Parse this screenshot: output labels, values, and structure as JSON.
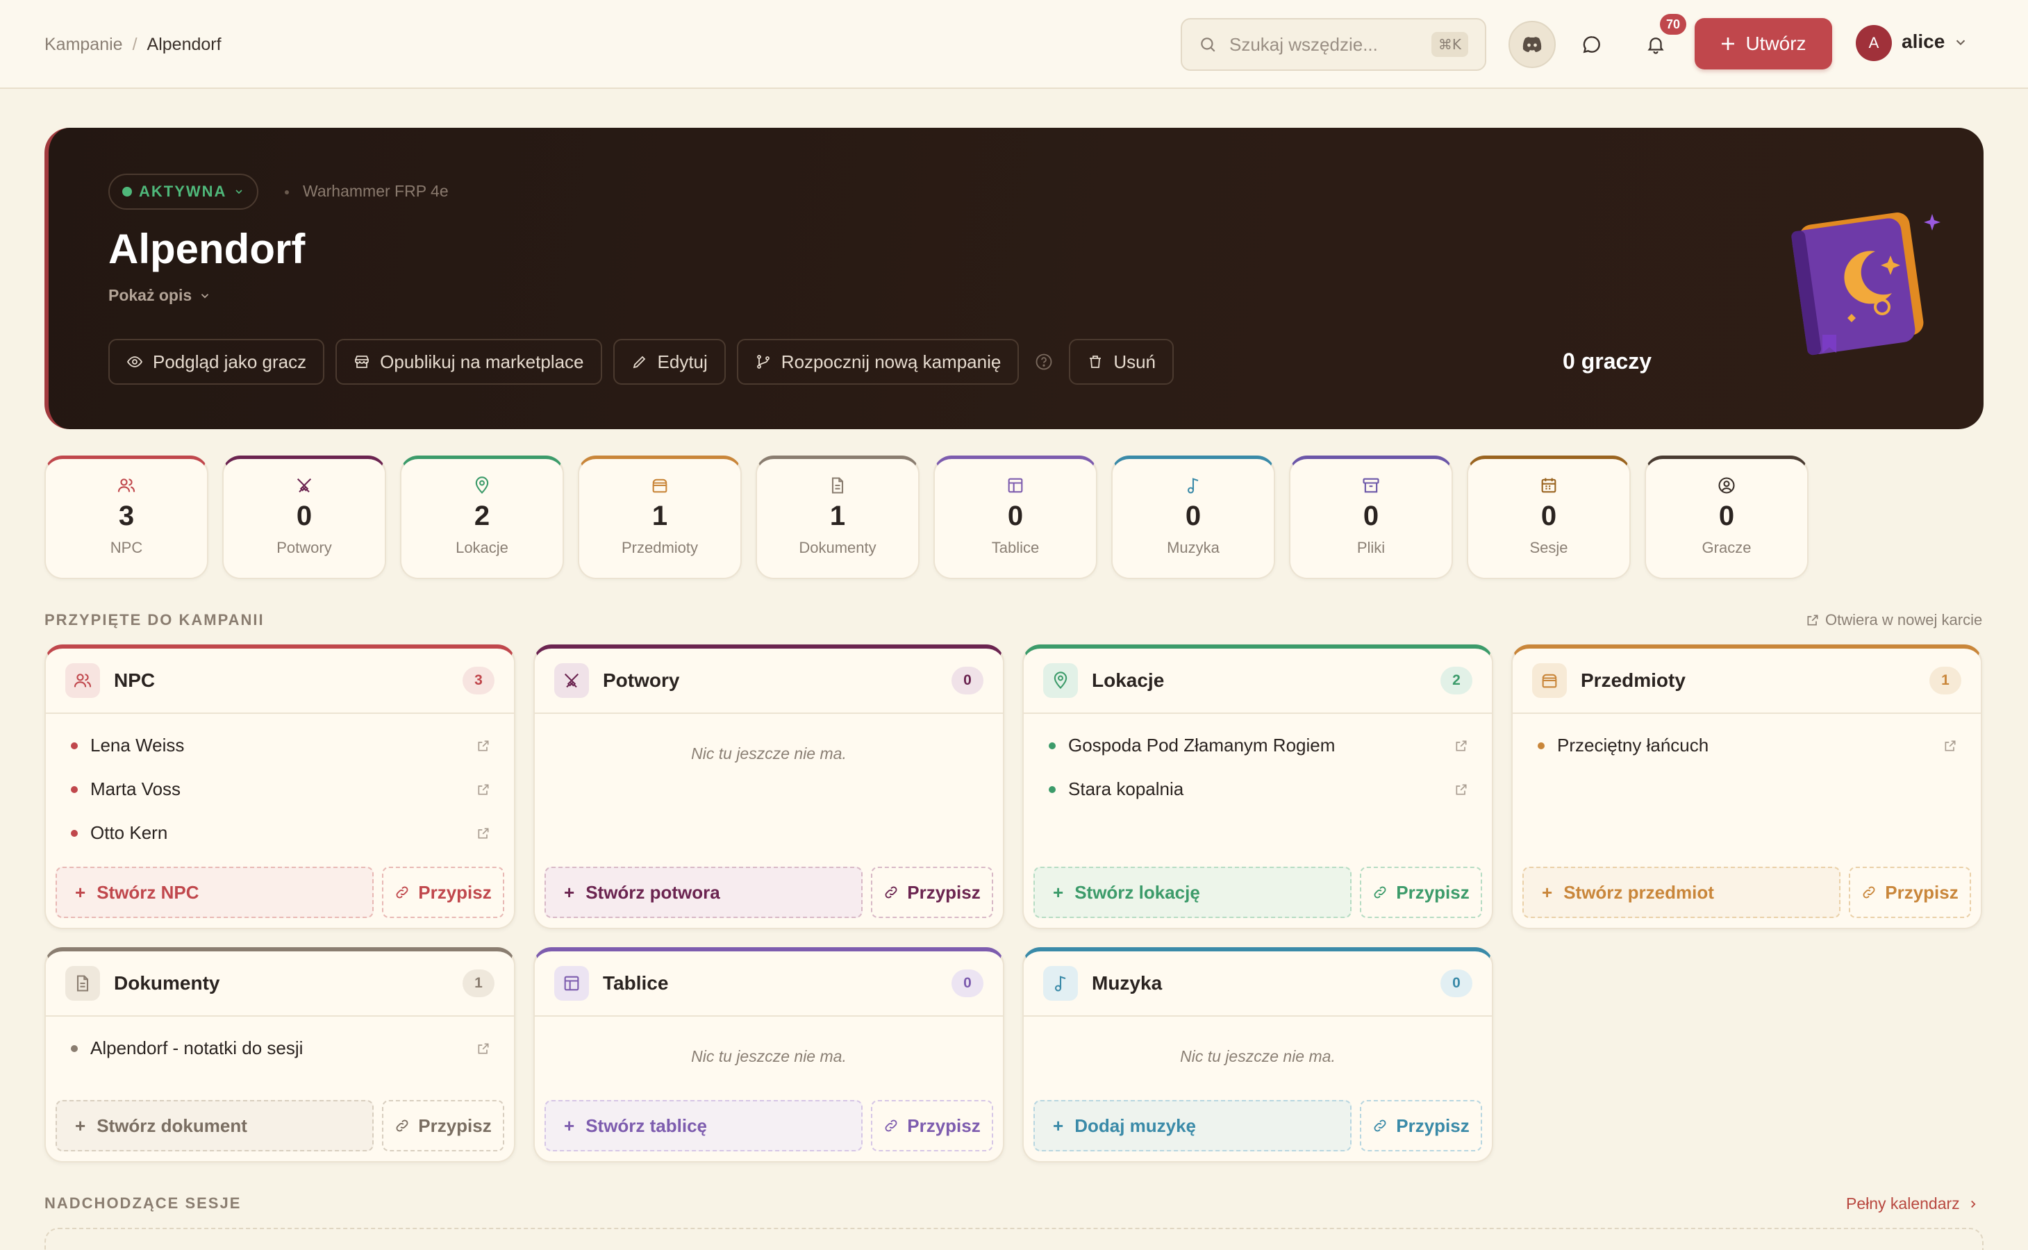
{
  "header": {
    "breadcrumb": {
      "parent": "Kampanie",
      "current": "Alpendorf"
    },
    "search": {
      "placeholder": "Szukaj wszędzie...",
      "shortcut": "⌘K"
    },
    "notifications_count": "70",
    "create_label": "Utwórz",
    "user": {
      "initial": "A",
      "name": "alice"
    }
  },
  "hero": {
    "status": "AKTYWNA",
    "system": "Warhammer FRP 4e",
    "title": "Alpendorf",
    "show_description": "Pokaż opis",
    "actions": {
      "preview": "Podgląd jako gracz",
      "publish": "Opublikuj na marketplace",
      "edit": "Edytuj",
      "new_campaign": "Rozpocznij nową kampanię",
      "delete": "Usuń"
    },
    "players": "0 graczy"
  },
  "stats": [
    {
      "value": "3",
      "label": "NPC",
      "color": "#c0474c",
      "icon": "users-icon"
    },
    {
      "value": "0",
      "label": "Potwory",
      "color": "#6b2450",
      "icon": "crossed-swords-icon"
    },
    {
      "value": "2",
      "label": "Lokacje",
      "color": "#3c9b6a",
      "icon": "map-pin-icon"
    },
    {
      "value": "1",
      "label": "Przedmioty",
      "color": "#c9863a",
      "icon": "chest-icon"
    },
    {
      "value": "1",
      "label": "Dokumenty",
      "color": "#8a7d70",
      "icon": "document-icon"
    },
    {
      "value": "0",
      "label": "Tablice",
      "color": "#7d5cae",
      "icon": "board-icon"
    },
    {
      "value": "0",
      "label": "Muzyka",
      "color": "#3a8aa8",
      "icon": "music-icon"
    },
    {
      "value": "0",
      "label": "Pliki",
      "color": "#6b56a8",
      "icon": "archive-icon"
    },
    {
      "value": "0",
      "label": "Sesje",
      "color": "#9a6420",
      "icon": "calendar-icon"
    },
    {
      "value": "0",
      "label": "Gracze",
      "color": "#4a3c32",
      "icon": "user-circle-icon"
    }
  ],
  "pinned": {
    "heading": "PRZYPIĘTE DO KAMPANII",
    "open_new": "Otwiera w nowej karcie",
    "empty_text": "Nic tu jeszcze nie ma.",
    "assign_label": "Przypisz",
    "panels": [
      {
        "title": "NPC",
        "count": "3",
        "color": "#c0474c",
        "items": [
          "Lena Weiss",
          "Marta Voss",
          "Otto Kern"
        ],
        "create": "Stwórz NPC"
      },
      {
        "title": "Potwory",
        "count": "0",
        "color": "#6b2450",
        "items": [],
        "create": "Stwórz potwora"
      },
      {
        "title": "Lokacje",
        "count": "2",
        "color": "#3c9b6a",
        "items": [
          "Gospoda Pod Złamanym Rogiem",
          "Stara kopalnia"
        ],
        "create": "Stwórz lokację"
      },
      {
        "title": "Przedmioty",
        "count": "1",
        "color": "#c9863a",
        "items": [
          "Przeciętny łańcuch"
        ],
        "create": "Stwórz przedmiot"
      },
      {
        "title": "Dokumenty",
        "count": "1",
        "color": "#8a7d70",
        "items": [
          "Alpendorf - notatki do sesji"
        ],
        "create": "Stwórz dokument"
      },
      {
        "title": "Tablice",
        "count": "0",
        "color": "#7d5cae",
        "items": [],
        "create": "Stwórz tablicę"
      },
      {
        "title": "Muzyka",
        "count": "0",
        "color": "#3a8aa8",
        "items": [],
        "create": "Dodaj muzykę"
      }
    ]
  },
  "sessions": {
    "heading": "NADCHODZĄCE SESJE",
    "calendar_link": "Pełny kalendarz"
  }
}
